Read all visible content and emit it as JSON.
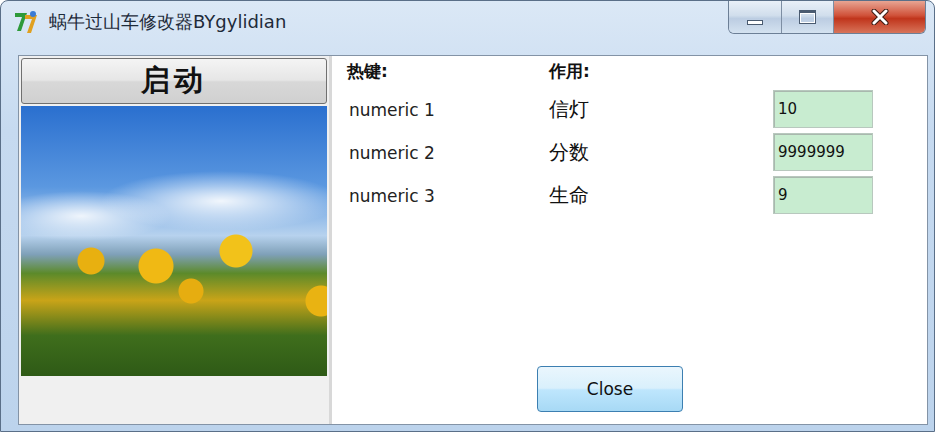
{
  "window": {
    "title": "蜗牛过山车修改器BYgylidian"
  },
  "start_button": "启动",
  "headers": {
    "hotkey": "热键:",
    "function": "作用:"
  },
  "rows": [
    {
      "hotkey": "numeric 1",
      "function": "信灯",
      "value": "10"
    },
    {
      "hotkey": "numeric 2",
      "function": "分数",
      "value": "9999999"
    },
    {
      "hotkey": "numeric 3",
      "function": "生命",
      "value": "9"
    }
  ],
  "buttons": [
    "Close"
  ]
}
